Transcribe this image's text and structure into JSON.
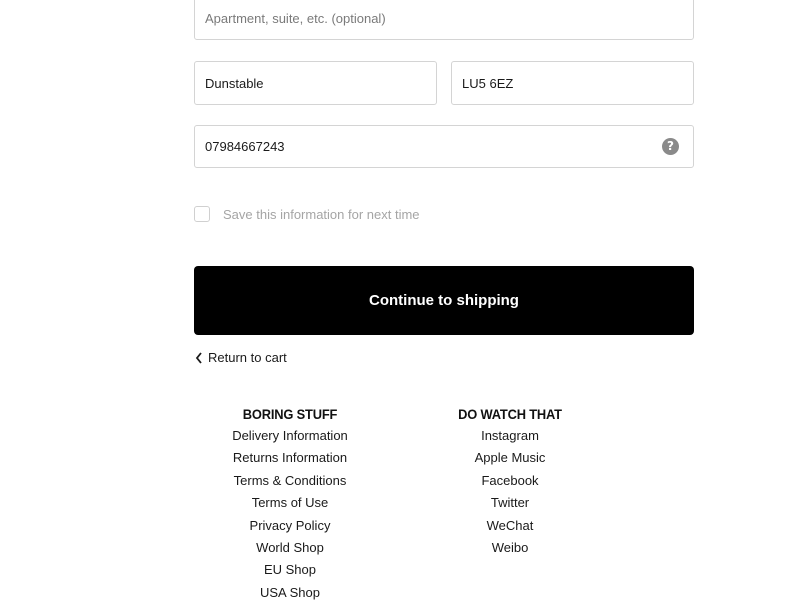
{
  "form": {
    "apartment": {
      "value": "",
      "placeholder": "Apartment, suite, etc. (optional)"
    },
    "city": {
      "value": "Dunstable"
    },
    "postcode": {
      "value": "LU5 6EZ"
    },
    "phone": {
      "value": "07984667243",
      "help_icon": "question-circle-icon",
      "help_glyph": "?"
    },
    "save_info": {
      "label": "Save this information for next time",
      "checked": false
    },
    "continue_label": "Continue to shipping",
    "return_label": "Return to cart"
  },
  "footer": {
    "boring": {
      "title": "BORING STUFF",
      "links": [
        "Delivery Information",
        "Returns Information",
        "Terms & Conditions",
        "Terms of Use",
        "Privacy Policy",
        "World Shop",
        "EU Shop",
        "USA Shop"
      ]
    },
    "watch": {
      "title": "DO WATCH THAT",
      "links": [
        "Instagram",
        "Apple Music",
        "Facebook",
        "Twitter",
        "WeChat",
        "Weibo"
      ]
    }
  },
  "colors": {
    "button_bg": "#000000",
    "button_text": "#ffffff",
    "field_border": "#d4d4d4",
    "muted_text": "#a5a5a5"
  }
}
